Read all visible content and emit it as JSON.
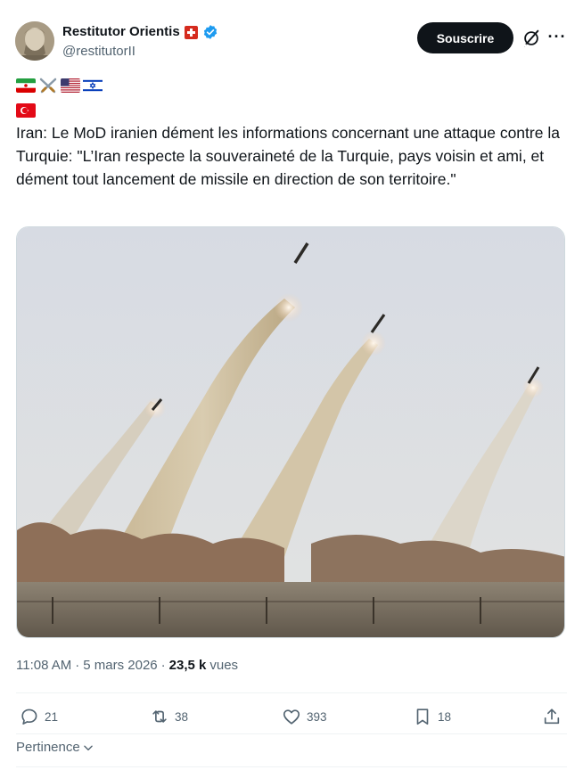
{
  "author": {
    "name": "Restitutor Orientis",
    "handle": "@restitutorII",
    "badge_icon": "swiss-flag-icon",
    "verified_icon": "verified-badge-icon"
  },
  "header": {
    "subscribe_label": "Souscrire",
    "grok_icon": "grok-icon",
    "more_icon": "more-icon"
  },
  "flags": [
    "flag-iran",
    "crossed-swords",
    "flag-usa",
    "flag-israel",
    "flag-turkey"
  ],
  "tweet": {
    "text": "Iran: Le MoD iranien dément les informations concernant une attaque contre la Turquie: \"L’Iran respecte la souveraineté de la Turquie, pays voisin et ami, et dément tout lancement de missile en direction de son territoire.\""
  },
  "media": {
    "description_icon": "missile-launch-photo"
  },
  "meta": {
    "time": "11:08 AM",
    "separator": "·",
    "date": "5 mars 2026",
    "views_count": "23,5 k",
    "views_label": "vues"
  },
  "actions": {
    "replies": "21",
    "reposts": "38",
    "likes": "393",
    "bookmarks": "18"
  },
  "sort": {
    "label": "Pertinence"
  },
  "colors": {
    "accent": "#0f1419",
    "secondary_text": "#536471",
    "verified": "#1d9bf0"
  }
}
